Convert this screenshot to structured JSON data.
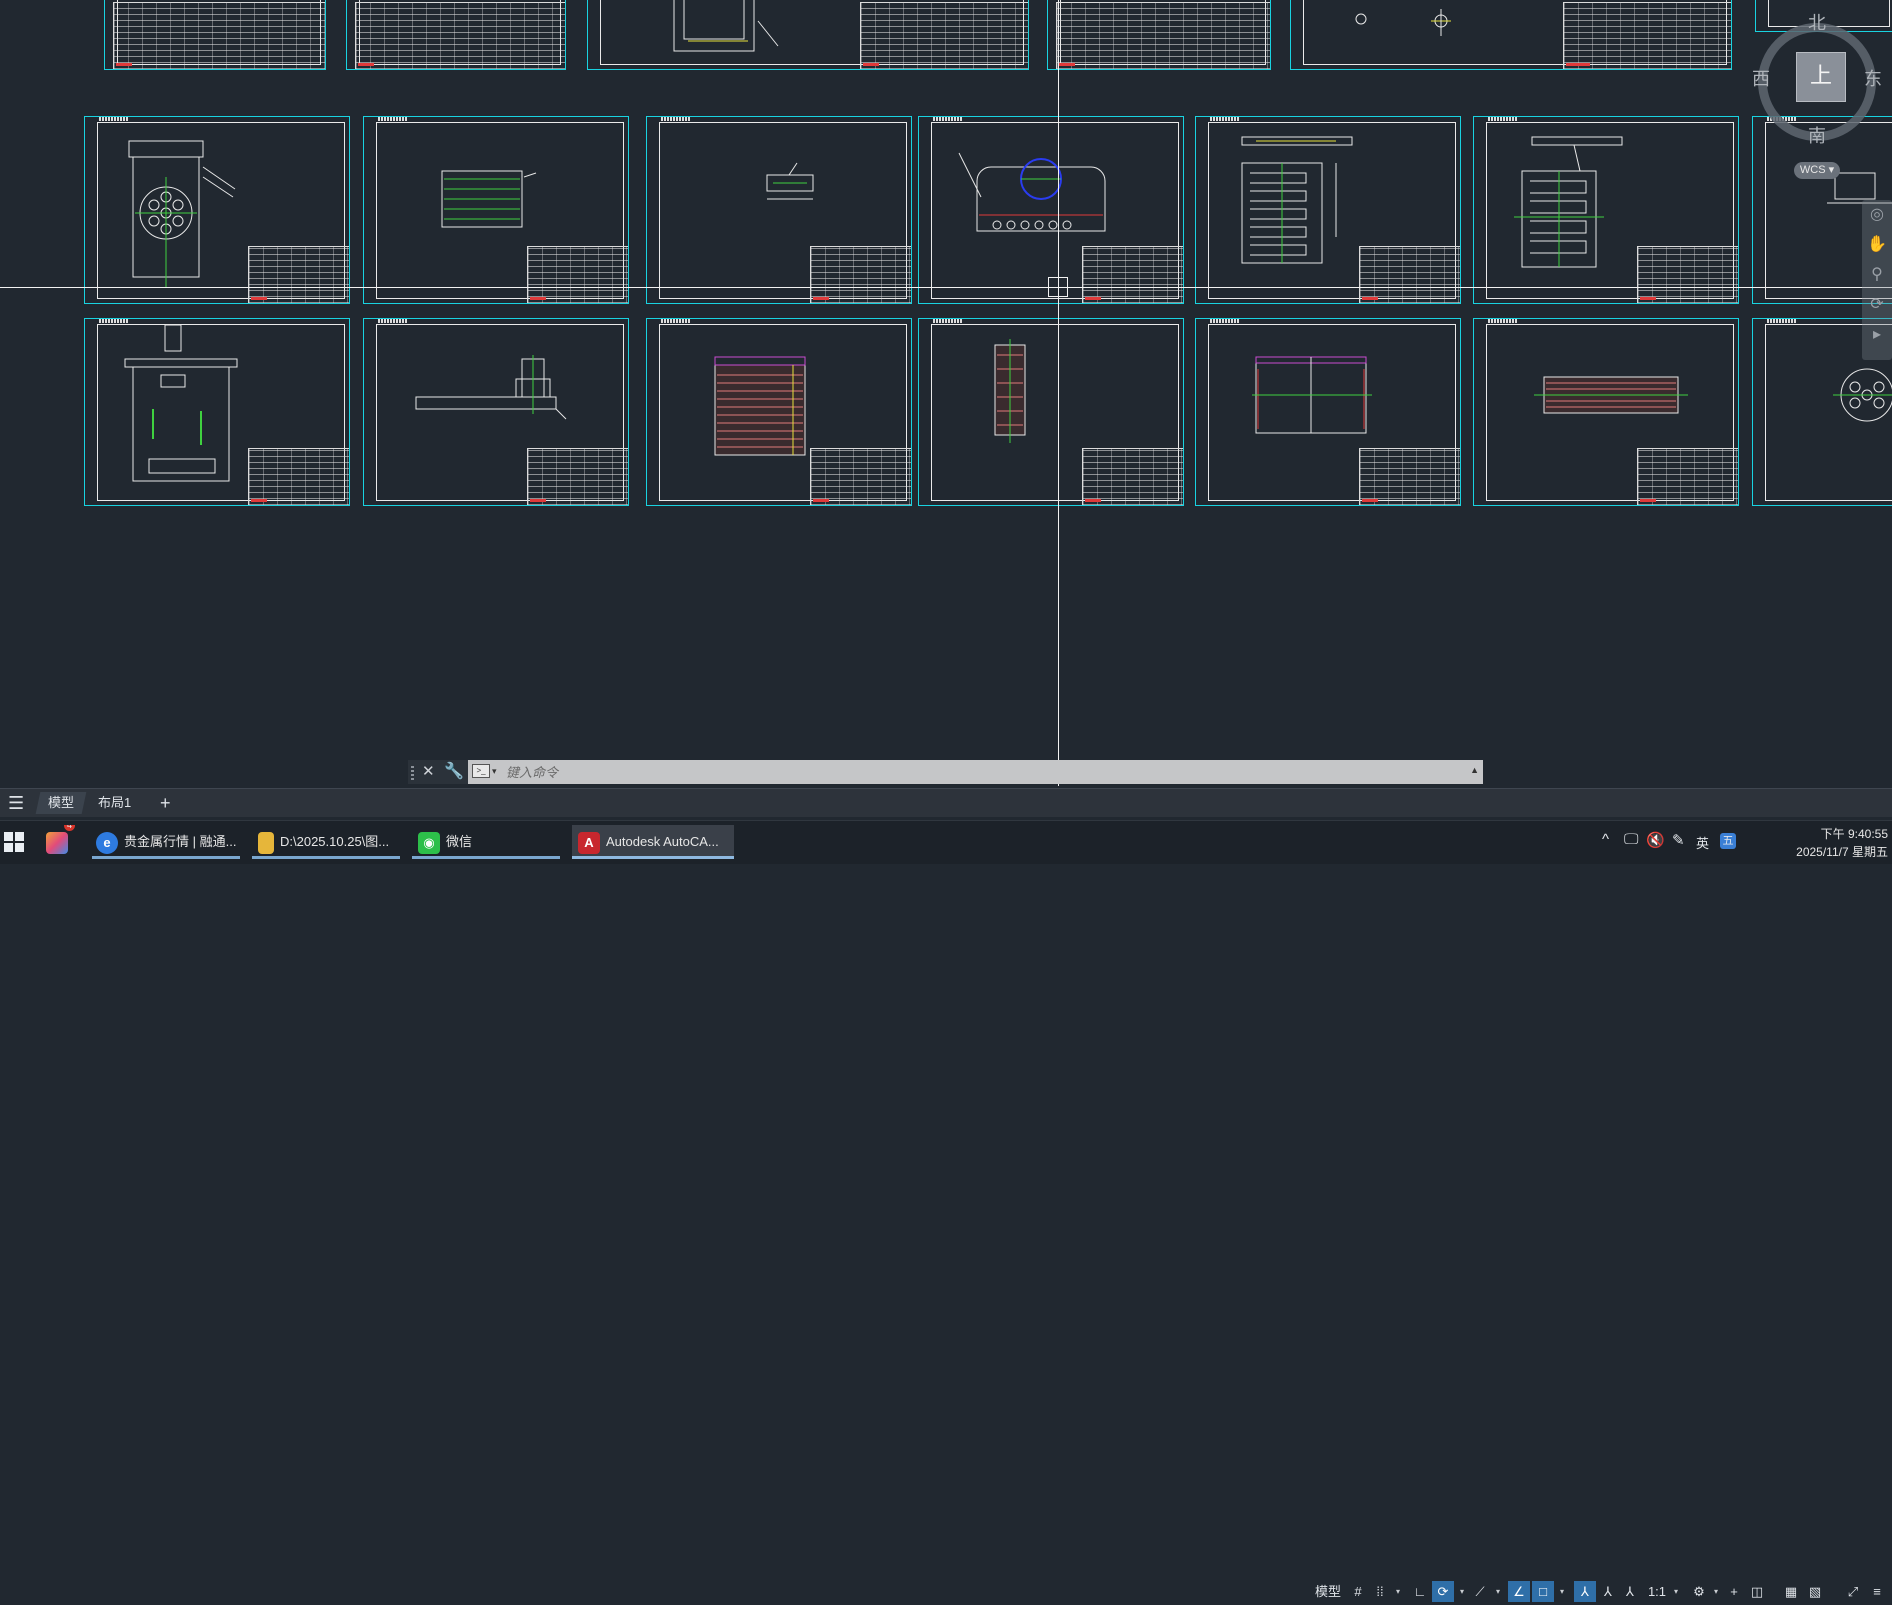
{
  "viewcube": {
    "north": "北",
    "south": "南",
    "west": "西",
    "east": "东",
    "face": "上",
    "wcs": "WCS"
  },
  "command_line": {
    "placeholder": "键入命令"
  },
  "layout_tabs": {
    "model": "模型",
    "layout1": "布局1",
    "add": "+"
  },
  "status_bar": {
    "model": "模型",
    "scale": "1:1"
  },
  "taskbar": {
    "apps": [
      {
        "label": "贵金属行情 | 融通...",
        "icon": "browser-icon"
      },
      {
        "label": "D:\\2025.10.25\\图...",
        "icon": "folder-icon"
      },
      {
        "label": "微信",
        "icon": "wechat-icon"
      },
      {
        "label": "Autodesk AutoCA...",
        "icon": "autocad-icon"
      }
    ],
    "badge": "4",
    "ime": "英",
    "time": "下午 9:40:55",
    "date": "2025/11/7 星期五"
  },
  "colors": {
    "background": "#212830",
    "frame": "#19d3e0",
    "highlight": "#2f6fa8"
  }
}
